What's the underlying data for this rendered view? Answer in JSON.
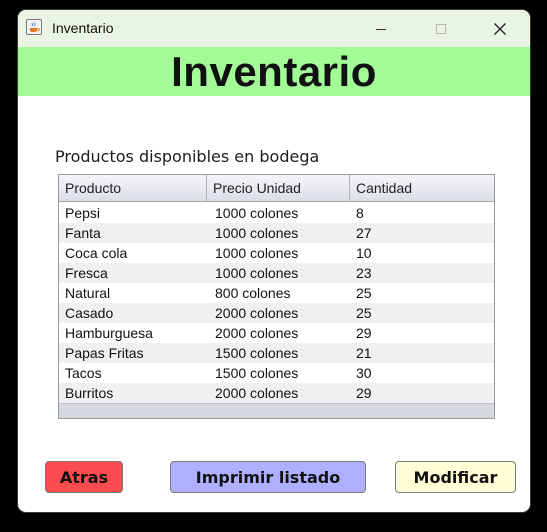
{
  "window": {
    "title": "Inventario",
    "controls": [
      "minimize",
      "maximize",
      "close"
    ]
  },
  "header": {
    "title": "Inventario",
    "background": "#a2fb97"
  },
  "section_label": "Productos disponibles en bodega",
  "table": {
    "columns": [
      "Producto",
      "Precio Unidad",
      "Cantidad"
    ],
    "rows": [
      [
        "Pepsi",
        "1000 colones",
        "8"
      ],
      [
        "Fanta",
        "1000 colones",
        "27"
      ],
      [
        "Coca cola",
        "1000 colones",
        "10"
      ],
      [
        "Fresca",
        "1000 colones",
        "23"
      ],
      [
        "Natural",
        "800 colones",
        "25"
      ],
      [
        "Casado",
        "2000 colones",
        "25"
      ],
      [
        "Hamburguesa",
        "2000 colones",
        "29"
      ],
      [
        "Papas Fritas",
        "1500 colones",
        "21"
      ],
      [
        "Tacos",
        "1500 colones",
        "30"
      ],
      [
        "Burritos",
        "2000 colones",
        "29"
      ]
    ]
  },
  "buttons": {
    "back": {
      "label": "Atras",
      "color": "#fb4d4f"
    },
    "print": {
      "label": "Imprimir listado",
      "color": "#aeafff"
    },
    "modify": {
      "label": "Modificar",
      "color": "#ffffd7"
    }
  }
}
